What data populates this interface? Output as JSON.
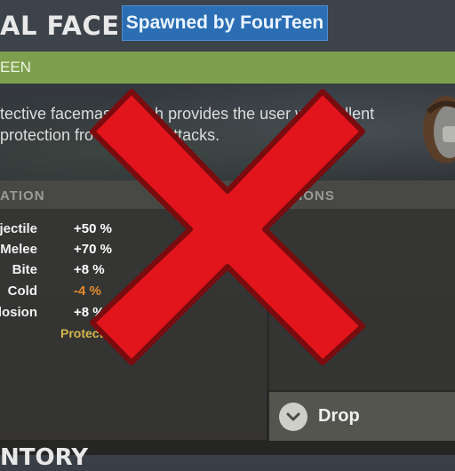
{
  "header": {
    "title": "AL FACEMAS",
    "spawn_badge": "Spawned by FourTeen",
    "subtitle": "EEN"
  },
  "description": {
    "line1": "tective facemask        h provides the user wi    cellent",
    "line2": "protection fro            of attacks."
  },
  "protection": {
    "header": "ATION",
    "rows": [
      {
        "label": "jectile",
        "value": "+50 %"
      },
      {
        "label": "Melee",
        "value": "+70 %"
      },
      {
        "label": "Bite",
        "value": "+8 %"
      },
      {
        "label": "Cold",
        "value": "-4 %"
      },
      {
        "label": "losion",
        "value": "+8 %"
      }
    ],
    "note": "Protect"
  },
  "actions": {
    "header": "TIONS",
    "drop_label": "Drop"
  },
  "footer": {
    "heading": "NTORY"
  },
  "icons": {
    "item": "facemask-item-icon",
    "drop": "chevron-down-icon",
    "overlay": "red-x-icon"
  },
  "colors": {
    "accent_green": "#7ea04e",
    "badge_blue": "#2b6eb3",
    "negative_orange": "#e48a2c",
    "note_yellow": "#d4b54a",
    "overlay_red": "#e3151c"
  }
}
